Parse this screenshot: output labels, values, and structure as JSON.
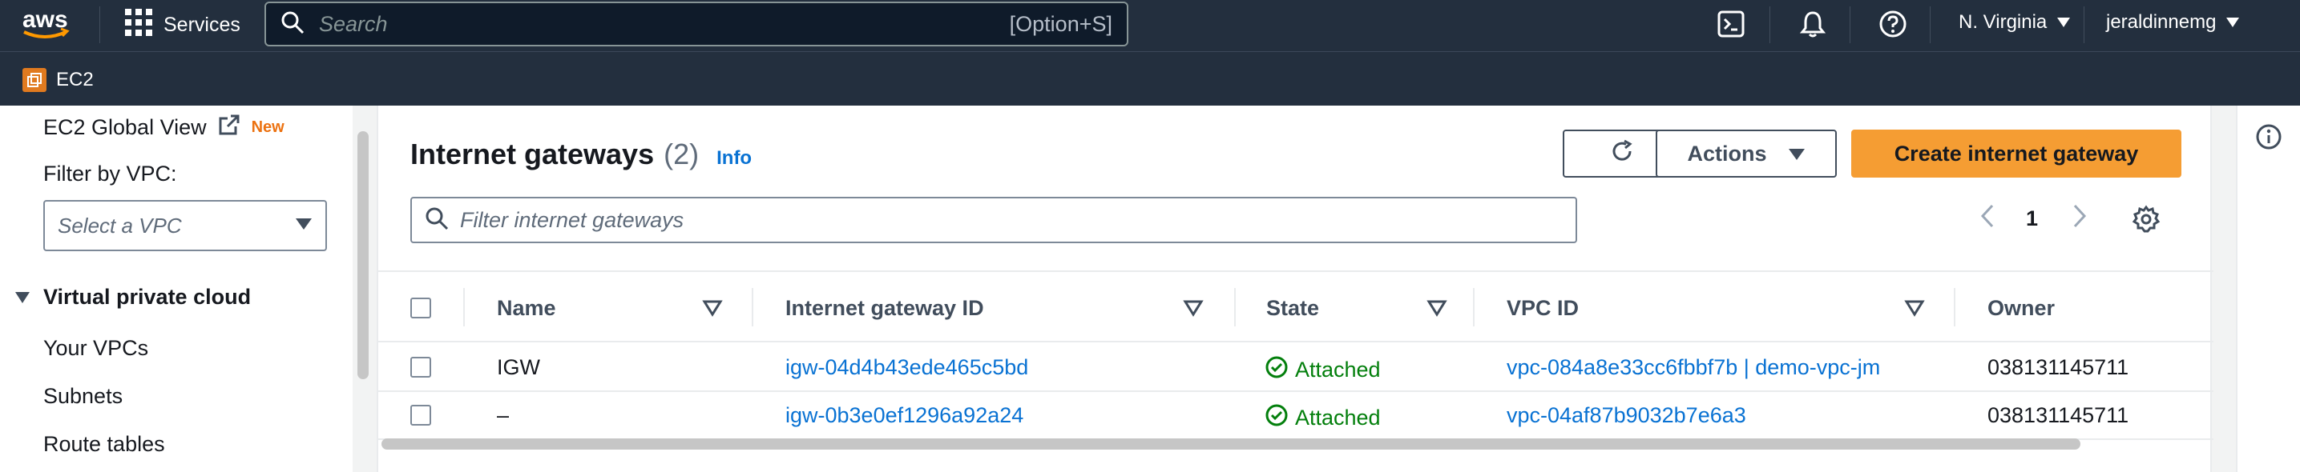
{
  "topnav": {
    "logo_text": "aws",
    "services_label": "Services",
    "search_placeholder": "Search",
    "search_shortcut": "[Option+S]",
    "region": "N. Virginia",
    "user": "jeraldinnemg"
  },
  "servicebar": {
    "service": "EC2"
  },
  "sidebar": {
    "global_view": "EC2 Global View",
    "new_badge": "New",
    "filter_label": "Filter by VPC:",
    "filter_placeholder": "Select a VPC",
    "section": "Virtual private cloud",
    "items": [
      "Your VPCs",
      "Subnets",
      "Route tables"
    ]
  },
  "main": {
    "title": "Internet gateways",
    "count": "(2)",
    "info": "Info",
    "actions": "Actions",
    "create": "Create internet gateway",
    "filter_placeholder": "Filter internet gateways",
    "page": "1",
    "columns": [
      "Name",
      "Internet gateway ID",
      "State",
      "VPC ID",
      "Owner"
    ],
    "rows": [
      {
        "name": "IGW",
        "id": "igw-04d4b43ede465c5bd",
        "state": "Attached",
        "vpc": "vpc-084a8e33cc6fbbf7b | demo-vpc-jm",
        "owner": "038131145711"
      },
      {
        "name": "–",
        "id": "igw-0b3e0ef1296a92a24",
        "state": "Attached",
        "vpc": "vpc-04af87b9032b7e6a3",
        "owner": "038131145711"
      }
    ]
  },
  "colors": {
    "nav": "#232f3e",
    "link": "#0972d3",
    "primary": "#f59d33",
    "success": "#037f0c"
  }
}
